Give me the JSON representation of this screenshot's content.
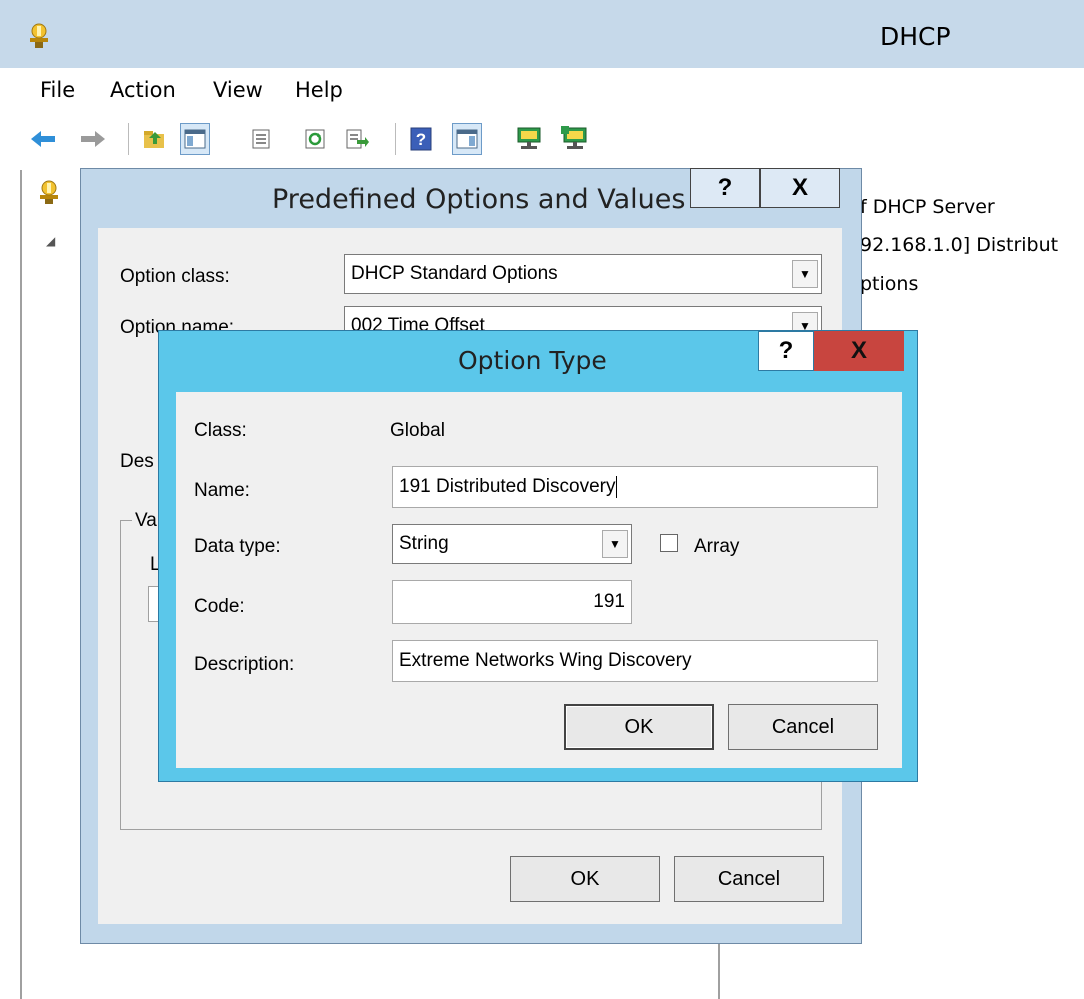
{
  "window": {
    "title": "DHCP",
    "menu": [
      "File",
      "Action",
      "View",
      "Help"
    ]
  },
  "toolbar": {
    "icons": [
      "back-icon",
      "forward-icon",
      "up-folder-icon",
      "show-hide-console-tree-icon",
      "properties-icon",
      "refresh-icon",
      "export-list-icon",
      "help-icon",
      "show-hide-action-pane-icon",
      "server-icon",
      "server-add-icon"
    ]
  },
  "right_pane": {
    "lines": [
      "f DHCP Server",
      "92.168.1.0] Distribut",
      "ptions"
    ]
  },
  "predefined_dialog": {
    "title": "Predefined Options and Values",
    "help_label": "?",
    "close_label": "X",
    "option_class_label": "Option class:",
    "option_class_value": "DHCP Standard Options",
    "option_name_label": "Option name:",
    "option_name_value": "002 Time Offset",
    "description_label": "Des",
    "value_group_label": "Va",
    "value_sub_label": "L",
    "ok_label": "OK",
    "cancel_label": "Cancel"
  },
  "option_type_dialog": {
    "title": "Option Type",
    "help_label": "?",
    "close_label": "X",
    "class_label": "Class:",
    "class_value": "Global",
    "name_label": "Name:",
    "name_value": "191 Distributed Discovery",
    "data_type_label": "Data type:",
    "data_type_value": "String",
    "array_label": "Array",
    "array_checked": false,
    "code_label": "Code:",
    "code_value": "191",
    "description_label": "Description:",
    "description_value": "Extreme Networks Wing Discovery",
    "ok_label": "OK",
    "cancel_label": "Cancel"
  }
}
